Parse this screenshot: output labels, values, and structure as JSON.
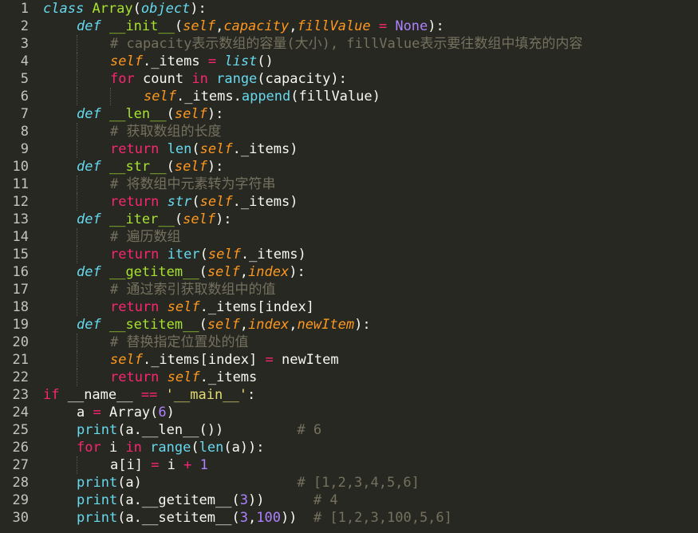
{
  "editor": {
    "language": "python",
    "theme_colors": {
      "background": "#272822",
      "keyword": "#f92672",
      "storage_italic": "#66d9ef",
      "class_or_function": "#a6e22e",
      "param_or_self": "#fd971f",
      "constant_or_number": "#ae81ff",
      "string": "#e6db74",
      "comment": "#75715e",
      "text": "#f8f8f2",
      "gutter": "#c4c4bc"
    },
    "lines": [
      {
        "n": "1",
        "indent": 0,
        "tokens": [
          [
            "st",
            "class"
          ],
          [
            "tx",
            " "
          ],
          [
            "cl",
            "Array"
          ],
          [
            "tx",
            "("
          ],
          [
            "st",
            "object"
          ],
          [
            "tx",
            "):"
          ]
        ]
      },
      {
        "n": "2",
        "indent": 1,
        "tokens": [
          [
            "st",
            "def"
          ],
          [
            "tx",
            " "
          ],
          [
            "fn",
            "__init__"
          ],
          [
            "tx",
            "("
          ],
          [
            "sf",
            "self"
          ],
          [
            "tx",
            ","
          ],
          [
            "pa",
            "capacity"
          ],
          [
            "tx",
            ","
          ],
          [
            "pa",
            "fillValue"
          ],
          [
            "tx",
            " "
          ],
          [
            "op",
            "="
          ],
          [
            "tx",
            " "
          ],
          [
            "cs",
            "None"
          ],
          [
            "tx",
            "):"
          ]
        ]
      },
      {
        "n": "3",
        "indent": 2,
        "tokens": [
          [
            "cm",
            "# capacity表示数组的容量(大小), fillValue表示要往数组中填充的内容"
          ]
        ]
      },
      {
        "n": "4",
        "indent": 2,
        "tokens": [
          [
            "sf",
            "self"
          ],
          [
            "tx",
            "._items "
          ],
          [
            "op",
            "="
          ],
          [
            "tx",
            " "
          ],
          [
            "st",
            "list"
          ],
          [
            "tx",
            "()"
          ]
        ]
      },
      {
        "n": "5",
        "indent": 2,
        "tokens": [
          [
            "kw",
            "for"
          ],
          [
            "tx",
            " count "
          ],
          [
            "kw",
            "in"
          ],
          [
            "tx",
            " "
          ],
          [
            "bi",
            "range"
          ],
          [
            "tx",
            "(capacity):"
          ]
        ]
      },
      {
        "n": "6",
        "indent": 3,
        "tokens": [
          [
            "sf",
            "self"
          ],
          [
            "tx",
            "._items."
          ],
          [
            "bi",
            "append"
          ],
          [
            "tx",
            "(fillValue)"
          ]
        ]
      },
      {
        "n": "7",
        "indent": 1,
        "tokens": [
          [
            "st",
            "def"
          ],
          [
            "tx",
            " "
          ],
          [
            "fn",
            "__len__"
          ],
          [
            "tx",
            "("
          ],
          [
            "sf",
            "self"
          ],
          [
            "tx",
            "):"
          ]
        ]
      },
      {
        "n": "8",
        "indent": 2,
        "tokens": [
          [
            "cm",
            "# 获取数组的长度"
          ]
        ]
      },
      {
        "n": "9",
        "indent": 2,
        "tokens": [
          [
            "kw",
            "return"
          ],
          [
            "tx",
            " "
          ],
          [
            "bi",
            "len"
          ],
          [
            "tx",
            "("
          ],
          [
            "sf",
            "self"
          ],
          [
            "tx",
            "._items)"
          ]
        ]
      },
      {
        "n": "10",
        "indent": 1,
        "tokens": [
          [
            "st",
            "def"
          ],
          [
            "tx",
            " "
          ],
          [
            "fn",
            "__str__"
          ],
          [
            "tx",
            "("
          ],
          [
            "sf",
            "self"
          ],
          [
            "tx",
            "):"
          ]
        ]
      },
      {
        "n": "11",
        "indent": 2,
        "tokens": [
          [
            "cm",
            "# 将数组中元素转为字符串"
          ]
        ]
      },
      {
        "n": "12",
        "indent": 2,
        "tokens": [
          [
            "kw",
            "return"
          ],
          [
            "tx",
            " "
          ],
          [
            "st",
            "str"
          ],
          [
            "tx",
            "("
          ],
          [
            "sf",
            "self"
          ],
          [
            "tx",
            "._items)"
          ]
        ]
      },
      {
        "n": "13",
        "indent": 1,
        "tokens": [
          [
            "st",
            "def"
          ],
          [
            "tx",
            " "
          ],
          [
            "fn",
            "__iter__"
          ],
          [
            "tx",
            "("
          ],
          [
            "sf",
            "self"
          ],
          [
            "tx",
            "):"
          ]
        ]
      },
      {
        "n": "14",
        "indent": 2,
        "tokens": [
          [
            "cm",
            "# 遍历数组"
          ]
        ]
      },
      {
        "n": "15",
        "indent": 2,
        "tokens": [
          [
            "kw",
            "return"
          ],
          [
            "tx",
            " "
          ],
          [
            "bi",
            "iter"
          ],
          [
            "tx",
            "("
          ],
          [
            "sf",
            "self"
          ],
          [
            "tx",
            "._items)"
          ]
        ]
      },
      {
        "n": "16",
        "indent": 1,
        "tokens": [
          [
            "st",
            "def"
          ],
          [
            "tx",
            " "
          ],
          [
            "fn",
            "__getitem__"
          ],
          [
            "tx",
            "("
          ],
          [
            "sf",
            "self"
          ],
          [
            "tx",
            ","
          ],
          [
            "pa",
            "index"
          ],
          [
            "tx",
            "):"
          ]
        ]
      },
      {
        "n": "17",
        "indent": 2,
        "tokens": [
          [
            "cm",
            "# 通过索引获取数组中的值"
          ]
        ]
      },
      {
        "n": "18",
        "indent": 2,
        "tokens": [
          [
            "kw",
            "return"
          ],
          [
            "tx",
            " "
          ],
          [
            "sf",
            "self"
          ],
          [
            "tx",
            "._items[index]"
          ]
        ]
      },
      {
        "n": "19",
        "indent": 1,
        "tokens": [
          [
            "st",
            "def"
          ],
          [
            "tx",
            " "
          ],
          [
            "fn",
            "__setitem__"
          ],
          [
            "tx",
            "("
          ],
          [
            "sf",
            "self"
          ],
          [
            "tx",
            ","
          ],
          [
            "pa",
            "index"
          ],
          [
            "tx",
            ","
          ],
          [
            "pa",
            "newItem"
          ],
          [
            "tx",
            "):"
          ]
        ]
      },
      {
        "n": "20",
        "indent": 2,
        "tokens": [
          [
            "cm",
            "# 替换指定位置处的值"
          ]
        ]
      },
      {
        "n": "21",
        "indent": 2,
        "tokens": [
          [
            "sf",
            "self"
          ],
          [
            "tx",
            "._items[index] "
          ],
          [
            "op",
            "="
          ],
          [
            "tx",
            " newItem"
          ]
        ]
      },
      {
        "n": "22",
        "indent": 2,
        "tokens": [
          [
            "kw",
            "return"
          ],
          [
            "tx",
            " "
          ],
          [
            "sf",
            "self"
          ],
          [
            "tx",
            "._items"
          ]
        ]
      },
      {
        "n": "23",
        "indent": 0,
        "tokens": [
          [
            "kw",
            "if"
          ],
          [
            "tx",
            " __name__ "
          ],
          [
            "op",
            "=="
          ],
          [
            "tx",
            " "
          ],
          [
            "str",
            "'__main__'"
          ],
          [
            "tx",
            ":"
          ]
        ]
      },
      {
        "n": "24",
        "indent": 1,
        "tokens": [
          [
            "tx",
            "a "
          ],
          [
            "op",
            "="
          ],
          [
            "tx",
            " "
          ],
          [
            "tx",
            "Array("
          ],
          [
            "nu",
            "6"
          ],
          [
            "tx",
            ")"
          ]
        ]
      },
      {
        "n": "25",
        "indent": 1,
        "tokens": [
          [
            "bi",
            "print"
          ],
          [
            "tx",
            "(a.__len__())         "
          ],
          [
            "cm",
            "# 6"
          ]
        ]
      },
      {
        "n": "26",
        "indent": 1,
        "tokens": [
          [
            "kw",
            "for"
          ],
          [
            "tx",
            " i "
          ],
          [
            "kw",
            "in"
          ],
          [
            "tx",
            " "
          ],
          [
            "bi",
            "range"
          ],
          [
            "tx",
            "("
          ],
          [
            "bi",
            "len"
          ],
          [
            "tx",
            "(a)):"
          ]
        ]
      },
      {
        "n": "27",
        "indent": 2,
        "tokens": [
          [
            "tx",
            "a[i] "
          ],
          [
            "op",
            "="
          ],
          [
            "tx",
            " i "
          ],
          [
            "op",
            "+"
          ],
          [
            "tx",
            " "
          ],
          [
            "nu",
            "1"
          ]
        ]
      },
      {
        "n": "28",
        "indent": 1,
        "tokens": [
          [
            "bi",
            "print"
          ],
          [
            "tx",
            "(a)                   "
          ],
          [
            "cm",
            "# [1,2,3,4,5,6]"
          ]
        ]
      },
      {
        "n": "29",
        "indent": 1,
        "tokens": [
          [
            "bi",
            "print"
          ],
          [
            "tx",
            "(a.__getitem__("
          ],
          [
            "nu",
            "3"
          ],
          [
            "tx",
            "))      "
          ],
          [
            "cm",
            "# 4"
          ]
        ]
      },
      {
        "n": "30",
        "indent": 1,
        "tokens": [
          [
            "bi",
            "print"
          ],
          [
            "tx",
            "(a.__setitem__("
          ],
          [
            "nu",
            "3"
          ],
          [
            "tx",
            ","
          ],
          [
            "nu",
            "100"
          ],
          [
            "tx",
            "))  "
          ],
          [
            "cm",
            "# [1,2,3,100,5,6]"
          ]
        ]
      }
    ]
  }
}
